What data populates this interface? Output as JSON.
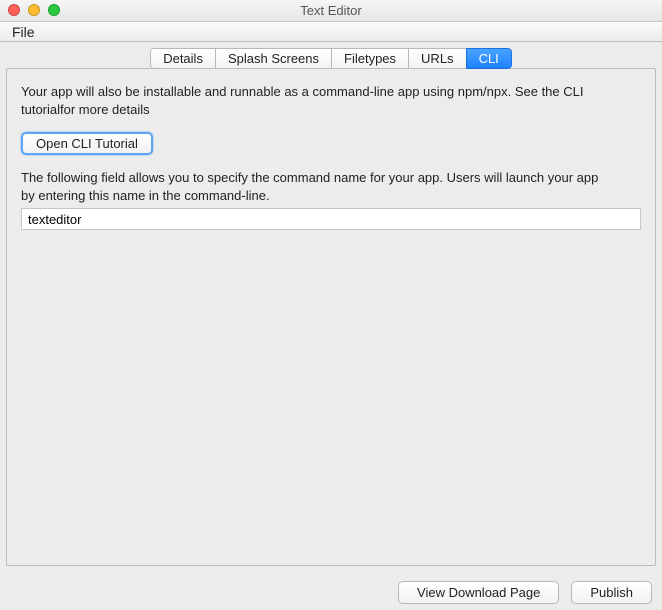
{
  "window": {
    "title": "Text Editor"
  },
  "menubar": {
    "file": "File"
  },
  "tabs": {
    "details": "Details",
    "splash": "Splash Screens",
    "filetypes": "Filetypes",
    "urls": "URLs",
    "cli": "CLI"
  },
  "cli": {
    "intro": "Your app will also be installable and runnable as a command-line app using npm/npx. See the CLI tutorialfor more details",
    "open_tutorial_btn": "Open CLI Tutorial",
    "cmdname_desc": "The following field allows you to specify the command name for your app. Users will launch your app by entering this name in the command-line.",
    "cmdname_value": "texteditor"
  },
  "footer": {
    "view_download": "View Download Page",
    "publish": "Publish"
  }
}
